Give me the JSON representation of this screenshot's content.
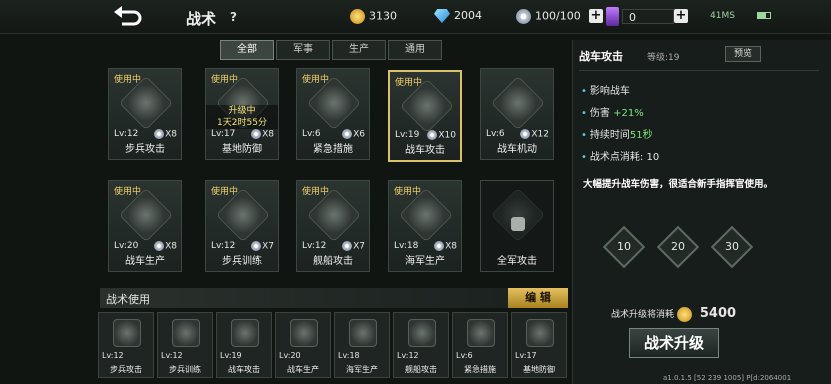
{
  "header": {
    "title": "战术",
    "help": "?",
    "gold": "3130",
    "diamond": "2004",
    "parts": "100/100",
    "medal": "0",
    "status": "41MS"
  },
  "tabs": [
    {
      "label": "全部",
      "active": true
    },
    {
      "label": "军事",
      "active": false
    },
    {
      "label": "生产",
      "active": false
    },
    {
      "label": "通用",
      "active": false
    }
  ],
  "cards": [
    {
      "name": "步兵攻击",
      "in_use": "使用中",
      "lv": "Lv:12",
      "count": "X8"
    },
    {
      "name": "基地防御",
      "in_use": "使用中",
      "lv": "Lv:17",
      "count": "X8",
      "upgrading": "升级中",
      "timer": "1天2时55分"
    },
    {
      "name": "紧急措施",
      "in_use": "使用中",
      "lv": "Lv:6",
      "count": "X6"
    },
    {
      "name": "战车攻击",
      "in_use": "使用中",
      "lv": "Lv:19",
      "count": "X10",
      "selected": true
    },
    {
      "name": "战车机动",
      "in_use": "",
      "lv": "Lv:6",
      "count": "X12"
    },
    {
      "name": "战车生产",
      "in_use": "使用中",
      "lv": "Lv:20",
      "count": "X8"
    },
    {
      "name": "步兵训练",
      "in_use": "使用中",
      "lv": "Lv:12",
      "count": "X7"
    },
    {
      "name": "舰船攻击",
      "in_use": "使用中",
      "lv": "Lv:12",
      "count": "X7"
    },
    {
      "name": "海军生产",
      "in_use": "使用中",
      "lv": "Lv:18",
      "count": "X8"
    },
    {
      "name": "全军攻击",
      "in_use": "",
      "lv": "",
      "count": "",
      "locked": true
    }
  ],
  "usage": {
    "label": "战术使用",
    "edit": "编 辑",
    "slots": [
      {
        "name": "步兵攻击",
        "lv": "Lv:12"
      },
      {
        "name": "步兵训练",
        "lv": "Lv:12"
      },
      {
        "name": "战车攻击",
        "lv": "Lv:19"
      },
      {
        "name": "战车生产",
        "lv": "Lv:20"
      },
      {
        "name": "海军生产",
        "lv": "Lv:18"
      },
      {
        "name": "舰船攻击",
        "lv": "Lv:12"
      },
      {
        "name": "紧急措施",
        "lv": "Lv:6"
      },
      {
        "name": "基地防御",
        "lv": "Lv:17"
      }
    ]
  },
  "panel": {
    "title": "战车攻击",
    "level": "等级:19",
    "preview": "预览",
    "effects": [
      {
        "label": "影响战车",
        "value": ""
      },
      {
        "label": "伤害",
        "value": "+21%"
      },
      {
        "label": "持续时间",
        "value": "51秒"
      },
      {
        "label": "战术点消耗:",
        "value": "10"
      }
    ],
    "description": "大幅提升战车伤害，很适合新手指挥官使用。",
    "level_buttons": [
      "10",
      "20",
      "30"
    ],
    "cost_label": "战术升级将消耗",
    "cost_value": "5400",
    "upgrade_button": "战术升级",
    "version": "a1.0.1.5 [52 239 1005] P[d:2064001"
  }
}
